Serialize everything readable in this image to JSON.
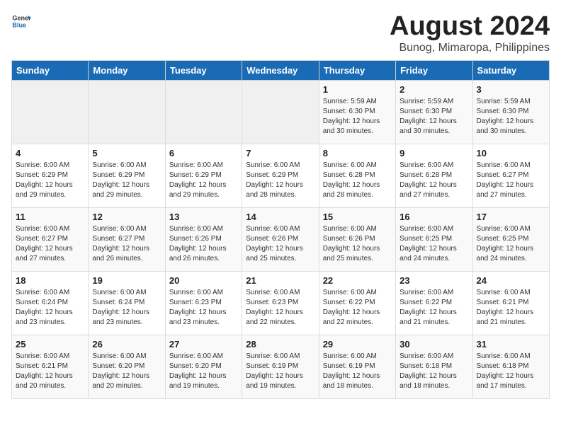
{
  "header": {
    "logo_general": "General",
    "logo_blue": "Blue",
    "title": "August 2024",
    "subtitle": "Bunog, Mimaropa, Philippines"
  },
  "weekdays": [
    "Sunday",
    "Monday",
    "Tuesday",
    "Wednesday",
    "Thursday",
    "Friday",
    "Saturday"
  ],
  "weeks": [
    [
      {
        "day": "",
        "info": ""
      },
      {
        "day": "",
        "info": ""
      },
      {
        "day": "",
        "info": ""
      },
      {
        "day": "",
        "info": ""
      },
      {
        "day": "1",
        "info": "Sunrise: 5:59 AM\nSunset: 6:30 PM\nDaylight: 12 hours and 30 minutes."
      },
      {
        "day": "2",
        "info": "Sunrise: 5:59 AM\nSunset: 6:30 PM\nDaylight: 12 hours and 30 minutes."
      },
      {
        "day": "3",
        "info": "Sunrise: 5:59 AM\nSunset: 6:30 PM\nDaylight: 12 hours and 30 minutes."
      }
    ],
    [
      {
        "day": "4",
        "info": "Sunrise: 6:00 AM\nSunset: 6:29 PM\nDaylight: 12 hours and 29 minutes."
      },
      {
        "day": "5",
        "info": "Sunrise: 6:00 AM\nSunset: 6:29 PM\nDaylight: 12 hours and 29 minutes."
      },
      {
        "day": "6",
        "info": "Sunrise: 6:00 AM\nSunset: 6:29 PM\nDaylight: 12 hours and 29 minutes."
      },
      {
        "day": "7",
        "info": "Sunrise: 6:00 AM\nSunset: 6:29 PM\nDaylight: 12 hours and 28 minutes."
      },
      {
        "day": "8",
        "info": "Sunrise: 6:00 AM\nSunset: 6:28 PM\nDaylight: 12 hours and 28 minutes."
      },
      {
        "day": "9",
        "info": "Sunrise: 6:00 AM\nSunset: 6:28 PM\nDaylight: 12 hours and 27 minutes."
      },
      {
        "day": "10",
        "info": "Sunrise: 6:00 AM\nSunset: 6:27 PM\nDaylight: 12 hours and 27 minutes."
      }
    ],
    [
      {
        "day": "11",
        "info": "Sunrise: 6:00 AM\nSunset: 6:27 PM\nDaylight: 12 hours and 27 minutes."
      },
      {
        "day": "12",
        "info": "Sunrise: 6:00 AM\nSunset: 6:27 PM\nDaylight: 12 hours and 26 minutes."
      },
      {
        "day": "13",
        "info": "Sunrise: 6:00 AM\nSunset: 6:26 PM\nDaylight: 12 hours and 26 minutes."
      },
      {
        "day": "14",
        "info": "Sunrise: 6:00 AM\nSunset: 6:26 PM\nDaylight: 12 hours and 25 minutes."
      },
      {
        "day": "15",
        "info": "Sunrise: 6:00 AM\nSunset: 6:26 PM\nDaylight: 12 hours and 25 minutes."
      },
      {
        "day": "16",
        "info": "Sunrise: 6:00 AM\nSunset: 6:25 PM\nDaylight: 12 hours and 24 minutes."
      },
      {
        "day": "17",
        "info": "Sunrise: 6:00 AM\nSunset: 6:25 PM\nDaylight: 12 hours and 24 minutes."
      }
    ],
    [
      {
        "day": "18",
        "info": "Sunrise: 6:00 AM\nSunset: 6:24 PM\nDaylight: 12 hours and 23 minutes."
      },
      {
        "day": "19",
        "info": "Sunrise: 6:00 AM\nSunset: 6:24 PM\nDaylight: 12 hours and 23 minutes."
      },
      {
        "day": "20",
        "info": "Sunrise: 6:00 AM\nSunset: 6:23 PM\nDaylight: 12 hours and 23 minutes."
      },
      {
        "day": "21",
        "info": "Sunrise: 6:00 AM\nSunset: 6:23 PM\nDaylight: 12 hours and 22 minutes."
      },
      {
        "day": "22",
        "info": "Sunrise: 6:00 AM\nSunset: 6:22 PM\nDaylight: 12 hours and 22 minutes."
      },
      {
        "day": "23",
        "info": "Sunrise: 6:00 AM\nSunset: 6:22 PM\nDaylight: 12 hours and 21 minutes."
      },
      {
        "day": "24",
        "info": "Sunrise: 6:00 AM\nSunset: 6:21 PM\nDaylight: 12 hours and 21 minutes."
      }
    ],
    [
      {
        "day": "25",
        "info": "Sunrise: 6:00 AM\nSunset: 6:21 PM\nDaylight: 12 hours and 20 minutes."
      },
      {
        "day": "26",
        "info": "Sunrise: 6:00 AM\nSunset: 6:20 PM\nDaylight: 12 hours and 20 minutes."
      },
      {
        "day": "27",
        "info": "Sunrise: 6:00 AM\nSunset: 6:20 PM\nDaylight: 12 hours and 19 minutes."
      },
      {
        "day": "28",
        "info": "Sunrise: 6:00 AM\nSunset: 6:19 PM\nDaylight: 12 hours and 19 minutes."
      },
      {
        "day": "29",
        "info": "Sunrise: 6:00 AM\nSunset: 6:19 PM\nDaylight: 12 hours and 18 minutes."
      },
      {
        "day": "30",
        "info": "Sunrise: 6:00 AM\nSunset: 6:18 PM\nDaylight: 12 hours and 18 minutes."
      },
      {
        "day": "31",
        "info": "Sunrise: 6:00 AM\nSunset: 6:18 PM\nDaylight: 12 hours and 17 minutes."
      }
    ]
  ]
}
